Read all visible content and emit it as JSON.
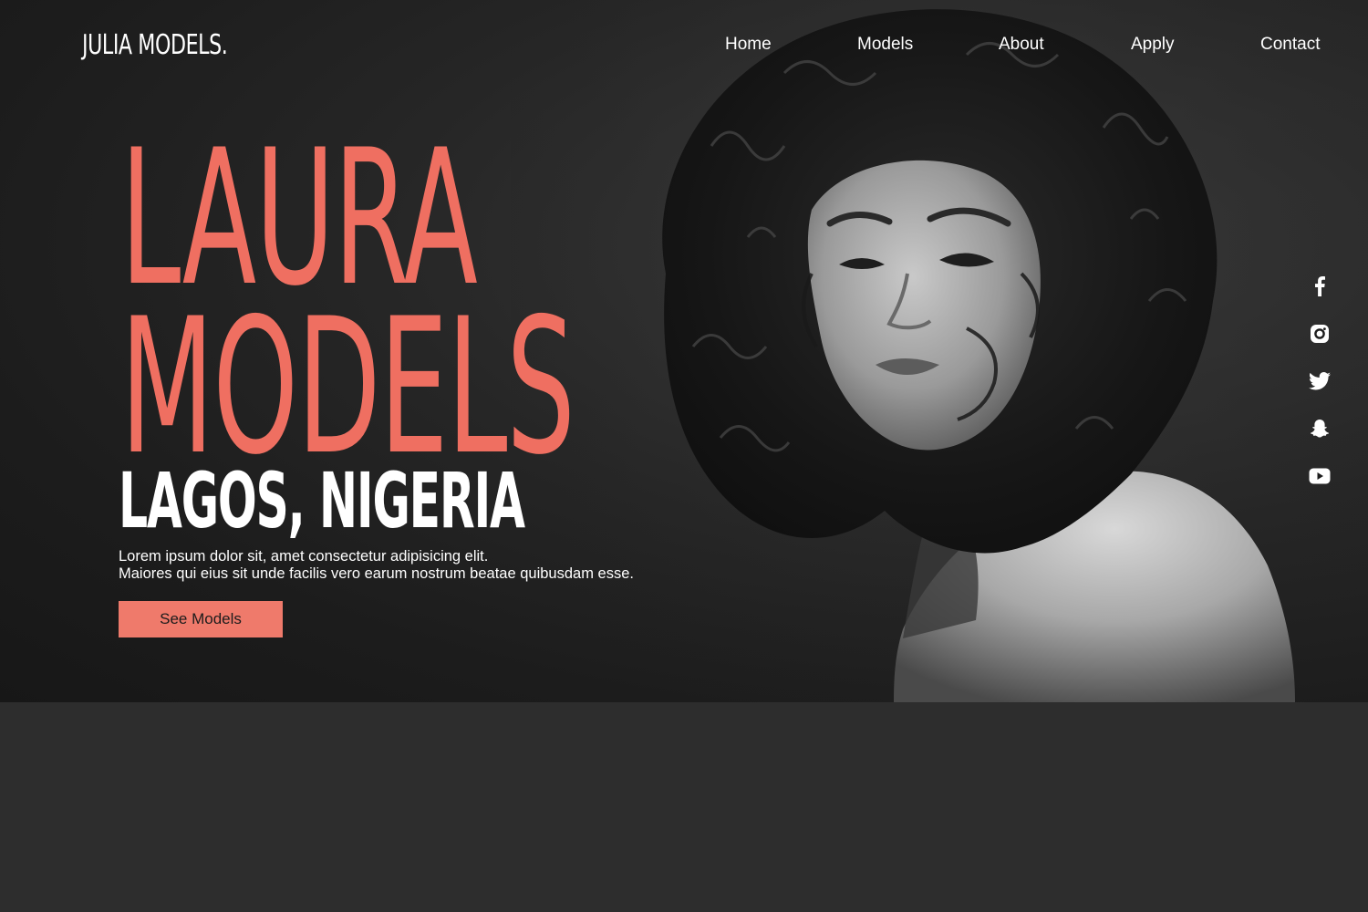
{
  "site": {
    "logo": "JULIA MODELS."
  },
  "nav": {
    "items": [
      {
        "label": "Home"
      },
      {
        "label": "Models"
      },
      {
        "label": "About"
      },
      {
        "label": "Apply"
      },
      {
        "label": "Contact"
      }
    ]
  },
  "hero": {
    "title_line1": "LAURA",
    "title_line2": "MODELS",
    "location": "LAGOS, NIGERIA",
    "description_line1": "Lorem ipsum dolor sit, amet consectetur adipisicing elit.",
    "description_line2": "Maiores qui eius sit unde facilis vero earum nostrum beatae quibusdam esse.",
    "cta_label": "See Models",
    "accent_color": "#ef6f61",
    "photo": "black-and-white portrait of woman with curly hair"
  },
  "social": {
    "icons": [
      "facebook-icon",
      "instagram-icon",
      "twitter-icon",
      "snapchat-icon",
      "youtube-icon"
    ]
  }
}
